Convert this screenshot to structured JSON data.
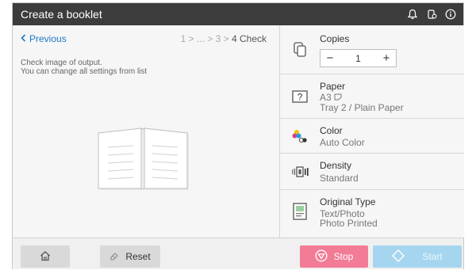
{
  "window": {
    "title": "Create a booklet"
  },
  "header_icons": [
    "bell-icon",
    "device-icon",
    "info-icon"
  ],
  "nav": {
    "previous_label": "Previous",
    "steps_prefix": "1 > ... > 3 >",
    "steps_current": "4 Check"
  },
  "message": {
    "line1": "Check image of output.",
    "line2": "You can change all settings from list"
  },
  "settings": {
    "copies": {
      "label": "Copies",
      "value": "1",
      "minus": "−",
      "plus": "+"
    },
    "paper": {
      "label": "Paper",
      "line1": "A3",
      "line2": "Tray 2 / Plain Paper"
    },
    "color": {
      "label": "Color",
      "value": "Auto Color"
    },
    "density": {
      "label": "Density",
      "value": "Standard"
    },
    "original_type": {
      "label": "Original Type",
      "line1": "Text/Photo",
      "line2": "Photo Printed"
    }
  },
  "footer": {
    "reset_label": "Reset",
    "stop_label": "Stop",
    "start_label": "Start"
  },
  "colors": {
    "stop": "#f27b96",
    "start": "#a6d6ef",
    "link": "#1f78c8",
    "titlebar": "#3c3c3c"
  }
}
